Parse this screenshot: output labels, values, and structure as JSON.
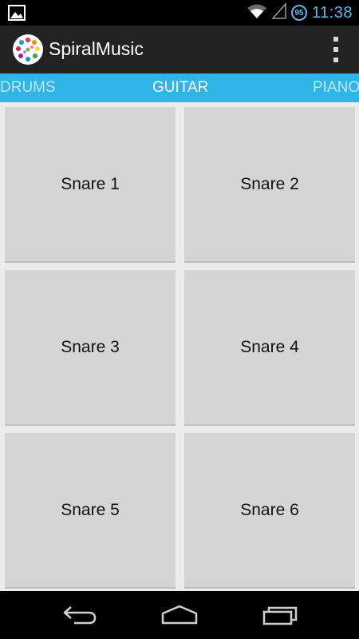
{
  "status_bar": {
    "time": "11:38",
    "battery_level": "95",
    "icons": [
      "gallery-notification-icon",
      "wifi-icon",
      "signal-icon",
      "battery-icon"
    ]
  },
  "action_bar": {
    "title": "SpiralMusic",
    "logo_icon": "spiral-logo-icon",
    "overflow_icon": "overflow-menu-icon"
  },
  "tabs": [
    {
      "label": "DRUMS",
      "selected": false
    },
    {
      "label": "GUITAR",
      "selected": true
    },
    {
      "label": "PIANO",
      "selected": false
    }
  ],
  "pads": [
    {
      "label": "Snare 1"
    },
    {
      "label": "Snare 2"
    },
    {
      "label": "Snare 3"
    },
    {
      "label": "Snare 4"
    },
    {
      "label": "Snare 5"
    },
    {
      "label": "Snare 6"
    }
  ],
  "nav_bar": {
    "buttons": [
      "back-icon",
      "home-icon",
      "recents-icon"
    ]
  },
  "colors": {
    "tab_strip": "#2fb5e8",
    "action_bar": "#222222",
    "pad": "#d6d5d6",
    "time": "#5fb8e7"
  }
}
